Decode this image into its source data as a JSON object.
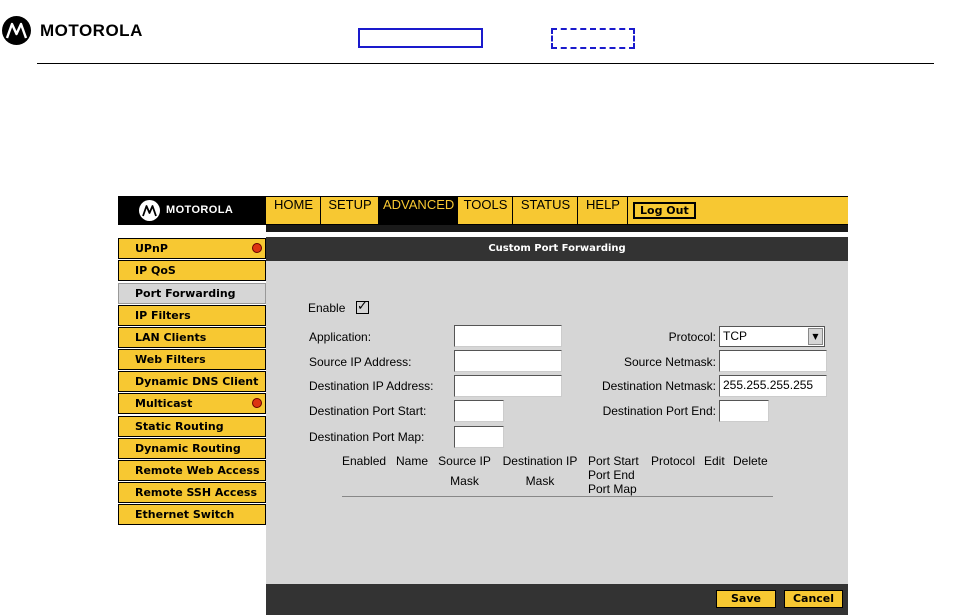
{
  "header": {
    "brand": "MOTOROLA"
  },
  "ui": {
    "brand": "MOTOROLA",
    "nav": [
      {
        "label": "HOME"
      },
      {
        "label": "SETUP"
      },
      {
        "label": "ADVANCED"
      },
      {
        "label": "TOOLS"
      },
      {
        "label": "STATUS"
      },
      {
        "label": "HELP"
      }
    ],
    "logout_label": "Log Out",
    "sidebar": [
      {
        "label": "UPnP"
      },
      {
        "label": "IP QoS"
      },
      {
        "label": "Port Forwarding"
      },
      {
        "label": "IP Filters"
      },
      {
        "label": "LAN Clients"
      },
      {
        "label": "Web Filters"
      },
      {
        "label": "Dynamic DNS Client"
      },
      {
        "label": "Multicast"
      },
      {
        "label": "Static Routing"
      },
      {
        "label": "Dynamic Routing"
      },
      {
        "label": "Remote Web Access"
      },
      {
        "label": "Remote SSH Access"
      },
      {
        "label": "Ethernet Switch"
      }
    ],
    "active_nav": "ADVANCED",
    "active_sidebar": "Port Forwarding"
  },
  "form": {
    "title": "Custom Port Forwarding",
    "enable_label": "Enable",
    "enable_checked": "✓",
    "application_label": "Application:",
    "application_value": "",
    "source_ip_label": "Source IP Address:",
    "source_ip_value": "",
    "dest_ip_label": "Destination IP Address:",
    "dest_ip_value": "",
    "dest_port_start_label": "Destination Port Start:",
    "dest_port_start_value": "",
    "dest_port_map_label": "Destination Port Map:",
    "dest_port_map_value": "",
    "protocol_label": "Protocol:",
    "protocol_value": "TCP",
    "source_netmask_label": "Source Netmask:",
    "source_netmask_value": "",
    "dest_netmask_label": "Destination Netmask:",
    "dest_netmask_value": "255.255.255.255",
    "dest_port_end_label": "Destination Port End:",
    "dest_port_end_value": ""
  },
  "table": {
    "headers": {
      "enabled": "Enabled",
      "name": "Name",
      "source_ip_mask_1": "Source IP",
      "source_ip_mask_2": "Mask",
      "dest_ip_mask_1": "Destination IP",
      "dest_ip_mask_2": "Mask",
      "port_1": "Port Start",
      "port_2": "Port End",
      "port_3": "Port Map",
      "protocol": "Protocol",
      "edit": "Edit",
      "delete": "Delete"
    }
  },
  "buttons": {
    "save": "Save",
    "cancel": "Cancel"
  },
  "colors": {
    "accent": "#f7c832",
    "dark": "#333333",
    "panel": "#d6d6d6",
    "header_box": "#1a1acc"
  }
}
